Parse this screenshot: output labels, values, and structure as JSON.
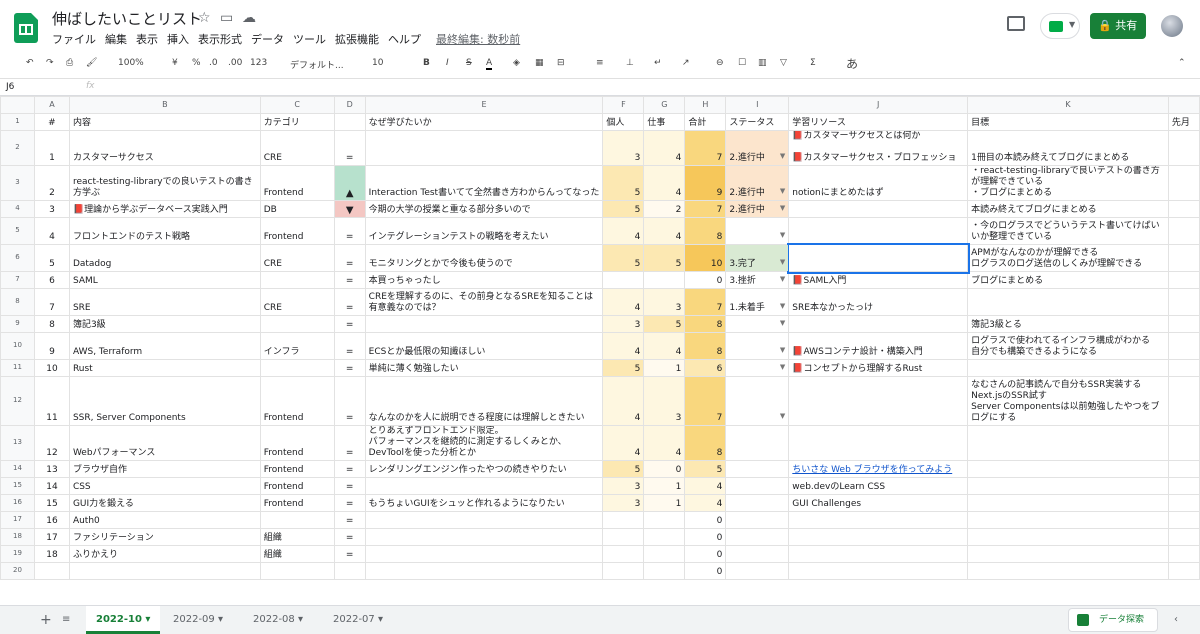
{
  "app": {
    "title": "伸ばしたいことリスト",
    "menus": [
      "ファイル",
      "編集",
      "表示",
      "挿入",
      "表示形式",
      "データ",
      "ツール",
      "拡張機能",
      "ヘルプ"
    ],
    "last_edit": "最終編集: 数秒前",
    "share": "共有"
  },
  "toolbar": {
    "zoom": "100%",
    "currency": "¥",
    "percent": "%",
    "dec_dec": ".0",
    "dec_inc": ".00",
    "format": "123",
    "font": "デフォルト...",
    "size": "10",
    "bold": "B",
    "italic": "I",
    "strike": "S",
    "text_color": "A",
    "input_mode": "あ"
  },
  "formula": {
    "cell": "J6",
    "fx": "fx",
    "value": ""
  },
  "cols": [
    "A",
    "B",
    "C",
    "D",
    "E",
    "F",
    "G",
    "H",
    "I",
    "J",
    "K"
  ],
  "rows": [
    {
      "a": "#",
      "b": "内容",
      "c": "カテゴリ",
      "d": "",
      "e": "なぜ学びたいか",
      "f": "個人",
      "g": "仕事",
      "h": "合計",
      "i": "ステータス",
      "j": "学習リソース",
      "k": "目標",
      "l": "先月"
    },
    {
      "a": "1",
      "b": "カスタマーサクセス",
      "c": "CRE",
      "d": "=",
      "e": "",
      "f": "3",
      "g": "4",
      "h": "7",
      "i": "2.進行中",
      "j": "📕カスタマーサクセスとは何か\n\n📕カスタマーサクセス・プロフェッショ",
      "k": "1冊目の本読み終えてブログにまとめる"
    },
    {
      "a": "2",
      "b": "react-testing-libraryでの良いテストの書き方学ぶ",
      "c": "Frontend",
      "d": "▲",
      "e": "Interaction Test書いてて全然書き方わからんってなった",
      "f": "5",
      "g": "4",
      "h": "9",
      "i": "2.進行中",
      "j": "notionにまとめたはず",
      "k": "・react-testing-libraryで良いテストの書き方が理解できている\n・ブログにまとめる"
    },
    {
      "a": "3",
      "b": "📕理論から学ぶデータベース実践入門",
      "c": "DB",
      "d": "▼",
      "e": "今期の大学の授業と重なる部分多いので",
      "f": "5",
      "g": "2",
      "h": "7",
      "i": "2.進行中",
      "j": "",
      "k": "本読み終えてブログにまとめる"
    },
    {
      "a": "4",
      "b": "フロントエンドのテスト戦略",
      "c": "Frontend",
      "d": "=",
      "e": "インテグレーションテストの戦略を考えたい",
      "f": "4",
      "g": "4",
      "h": "8",
      "i": "",
      "j": "",
      "k": "・今のログラスでどういうテスト書いてけばいいか整理できている"
    },
    {
      "a": "5",
      "b": "Datadog",
      "c": "CRE",
      "d": "=",
      "e": "モニタリングとかで今後も使うので",
      "f": "5",
      "g": "5",
      "h": "10",
      "i": "3.完了",
      "j": "",
      "k": "APMがなんなのかが理解できる\nログラスのログ送信のしくみが理解できる"
    },
    {
      "a": "6",
      "b": "SAML",
      "c": "",
      "d": "=",
      "e": "本買っちゃったし",
      "f": "",
      "g": "",
      "h": "0",
      "i": "3.挫折",
      "j": "📕SAML入門",
      "k": "ブログにまとめる"
    },
    {
      "a": "7",
      "b": "SRE",
      "c": "CRE",
      "d": "=",
      "e": "CREを理解するのに、その前身となるSREを知ることは有意義なのでは？",
      "f": "4",
      "g": "3",
      "h": "7",
      "i": "1.未着手",
      "j": "SRE本なかったっけ",
      "k": ""
    },
    {
      "a": "8",
      "b": "簿記3級",
      "c": "",
      "d": "=",
      "e": "",
      "f": "3",
      "g": "5",
      "h": "8",
      "i": "",
      "j": "",
      "k": "簿記3級とる"
    },
    {
      "a": "9",
      "b": "AWS, Terraform",
      "c": "インフラ",
      "d": "=",
      "e": "ECSとか最低限の知識ほしい",
      "f": "4",
      "g": "4",
      "h": "8",
      "i": "",
      "j": "📕AWSコンテナ設計・構築入門",
      "k": "ログラスで使われてるインフラ構成がわかる\n自分でも構築できるようになる"
    },
    {
      "a": "10",
      "b": "Rust",
      "c": "",
      "d": "=",
      "e": "単純に薄く勉強したい",
      "f": "5",
      "g": "1",
      "h": "6",
      "i": "",
      "j": "📕コンセプトから理解するRust",
      "k": ""
    },
    {
      "a": "11",
      "b": "SSR, Server Components",
      "c": "Frontend",
      "d": "=",
      "e": "なんなのかを人に説明できる程度には理解しときたい",
      "f": "4",
      "g": "3",
      "h": "7",
      "i": "",
      "j": "",
      "k": "なむさんの記事読んで自分もSSR実装する\nNext.jsのSSR試す\nServer Componentsは以前勉強したやつをブログにする"
    },
    {
      "a": "12",
      "b": "Webパフォーマンス",
      "c": "Frontend",
      "d": "=",
      "e": "とりあえずフロントエンド限定。\nパフォーマンスを継続的に測定するしくみとか、DevToolを使った分析とか",
      "f": "4",
      "g": "4",
      "h": "8",
      "i": "",
      "j": "",
      "k": ""
    },
    {
      "a": "13",
      "b": "ブラウザ自作",
      "c": "Frontend",
      "d": "=",
      "e": "レンダリングエンジン作ったやつの続きやりたい",
      "f": "5",
      "g": "0",
      "h": "5",
      "i": "",
      "j": "ちいさな Web ブラウザを作ってみよう",
      "k": ""
    },
    {
      "a": "14",
      "b": "CSS",
      "c": "Frontend",
      "d": "=",
      "e": "",
      "f": "3",
      "g": "1",
      "h": "4",
      "i": "",
      "j": "web.devのLearn CSS",
      "k": ""
    },
    {
      "a": "15",
      "b": "GUI力を鍛える",
      "c": "Frontend",
      "d": "=",
      "e": "もうちょいGUIをシュッと作れるようになりたい",
      "f": "3",
      "g": "1",
      "h": "4",
      "i": "",
      "j": "GUI Challenges",
      "k": ""
    },
    {
      "a": "16",
      "b": "Auth0",
      "c": "",
      "d": "=",
      "e": "",
      "f": "",
      "g": "",
      "h": "0",
      "i": "",
      "j": "",
      "k": ""
    },
    {
      "a": "17",
      "b": "ファシリテーション",
      "c": "組織",
      "d": "=",
      "e": "",
      "f": "",
      "g": "",
      "h": "0",
      "i": "",
      "j": "",
      "k": ""
    },
    {
      "a": "18",
      "b": "ふりかえり",
      "c": "組織",
      "d": "=",
      "e": "",
      "f": "",
      "g": "",
      "h": "0",
      "i": "",
      "j": "",
      "k": ""
    },
    {
      "a": "",
      "b": "",
      "c": "",
      "d": "",
      "e": "",
      "f": "",
      "g": "",
      "h": "0",
      "i": "",
      "j": "",
      "k": ""
    }
  ],
  "sheets": [
    "2022-10",
    "2022-09",
    "2022-08",
    "2022-07"
  ],
  "explore": "データ探索",
  "colors": {
    "accent": "#188038",
    "heat_low": "#fef7e0",
    "heat_mid": "#fce8b2",
    "heat_high": "#f9d77e",
    "status_progress": "#fce5cd",
    "status_done": "#d9ead3",
    "up": "#b7e1cd",
    "down": "#f4c7c3"
  }
}
